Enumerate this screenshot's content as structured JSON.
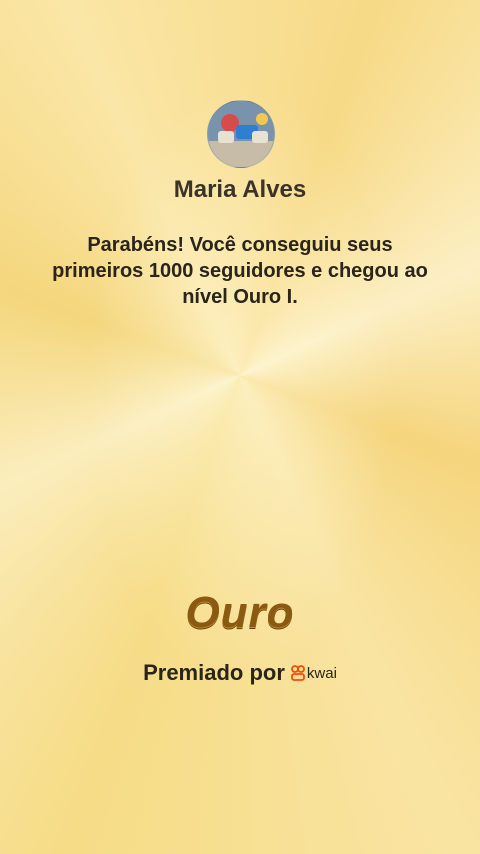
{
  "profile": {
    "username": "Maria Alves"
  },
  "message": "Parabéns! Você conseguiu seus primeiros 1000 seguidores e chegou ao nível Ouro I.",
  "badge": {
    "label": "Ouro"
  },
  "award": {
    "label": "Premiado por",
    "brand": "kwai"
  },
  "colors": {
    "brand": "#ff4906",
    "badge": "#8a5a12"
  }
}
